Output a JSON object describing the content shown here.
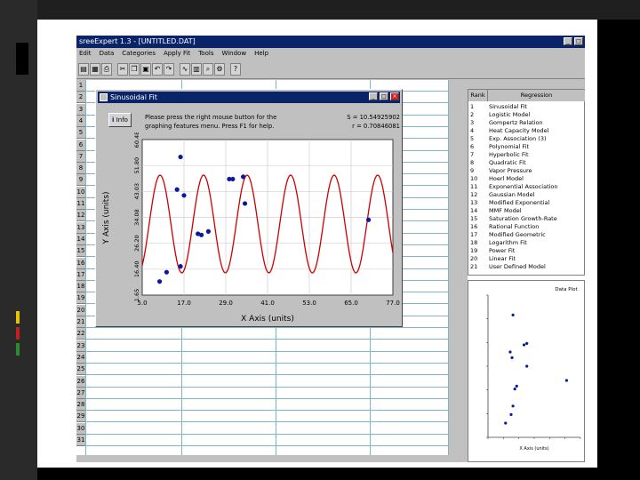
{
  "app": {
    "title": "sreeExpert 1.3 - [UNTITLED.DAT]",
    "menu": [
      "Edit",
      "Data",
      "Categories",
      "Apply Fit",
      "Tools",
      "Window",
      "Help"
    ]
  },
  "toolbar": {
    "icons": [
      "open-icon",
      "save-icon",
      "print-icon",
      "cut-icon",
      "copy-icon",
      "paste-icon",
      "undo-icon",
      "redo-icon",
      "fit-icon",
      "chart-icon",
      "zoom-icon",
      "settings-icon",
      "help-icon"
    ]
  },
  "sheet": {
    "row_labels": [
      "1",
      "2",
      "3",
      "4",
      "5",
      "6",
      "7",
      "8",
      "9",
      "10",
      "11",
      "12",
      "13",
      "14",
      "15",
      "16",
      "17",
      "18",
      "19",
      "20",
      "21",
      "22",
      "23",
      "24",
      "25",
      "26",
      "27",
      "28",
      "29",
      "30",
      "31"
    ]
  },
  "fit_window": {
    "title": "Sinusoidal Fit",
    "info_label": "Info",
    "help_line1": "Please press the right mouse button for the",
    "help_line2": "graphing features menu.  Press F1 for help.",
    "s_value": "S = 10.54925902",
    "r_value": "r = 0.70846081",
    "xlabel": "X Axis (units)",
    "ylabel": "Y Axis (units)"
  },
  "chart_data": {
    "type": "scatter",
    "xlabel": "X Axis (units)",
    "ylabel": "Y Axis (units)",
    "xlim": [
      5.0,
      77.0
    ],
    "ylim": [
      1.65,
      68.48
    ],
    "x_ticks": [
      "5.0",
      "17.0",
      "29.0",
      "41.0",
      "53.0",
      "65.0",
      "77.0"
    ],
    "y_ticks": [
      "1.65",
      "16.40",
      "26.20",
      "34.08",
      "43.03",
      "51.80",
      "60.48"
    ],
    "points": [
      {
        "x": 10.0,
        "y": 7.5
      },
      {
        "x": 12.0,
        "y": 11.5
      },
      {
        "x": 15.0,
        "y": 47.0
      },
      {
        "x": 16.0,
        "y": 61.0
      },
      {
        "x": 16.0,
        "y": 14.0
      },
      {
        "x": 17.0,
        "y": 44.5
      },
      {
        "x": 21.0,
        "y": 28.0
      },
      {
        "x": 22.0,
        "y": 27.5
      },
      {
        "x": 24.0,
        "y": 29.0
      },
      {
        "x": 30.0,
        "y": 51.5
      },
      {
        "x": 31.0,
        "y": 51.5
      },
      {
        "x": 34.0,
        "y": 52.5
      },
      {
        "x": 34.5,
        "y": 41.0
      },
      {
        "x": 70.0,
        "y": 34.0
      }
    ],
    "fit": {
      "offset": 32.2,
      "amplitude": 21.0,
      "period": 12.5,
      "phase_x": 7.0
    },
    "line_color": "#cc0000",
    "point_color": "#0a1aa0"
  },
  "regression_table": {
    "headers": [
      "Rank",
      "Regression"
    ],
    "rows": [
      {
        "n": "1",
        "name": "Sinusoidal Fit"
      },
      {
        "n": "2",
        "name": "Logistic Model"
      },
      {
        "n": "3",
        "name": "Gompertz Relation"
      },
      {
        "n": "4",
        "name": "Heat Capacity Model"
      },
      {
        "n": "5",
        "name": "Exp. Association (3)"
      },
      {
        "n": "6",
        "name": "Polynomial Fit"
      },
      {
        "n": "7",
        "name": "Hyperbolic Fit"
      },
      {
        "n": "8",
        "name": "Quadratic Fit"
      },
      {
        "n": "9",
        "name": "Vapor Pressure"
      },
      {
        "n": "10",
        "name": "Hoerl Model"
      },
      {
        "n": "11",
        "name": "Exponential Association"
      },
      {
        "n": "12",
        "name": "Gaussian Model"
      },
      {
        "n": "13",
        "name": "Modified Exponential"
      },
      {
        "n": "14",
        "name": "MMF Model"
      },
      {
        "n": "15",
        "name": "Saturation Growth-Rate"
      },
      {
        "n": "16",
        "name": "Rational Function"
      },
      {
        "n": "17",
        "name": "Modified Geometric"
      },
      {
        "n": "18",
        "name": "Logarithm Fit"
      },
      {
        "n": "19",
        "name": "Power Fit"
      },
      {
        "n": "20",
        "name": "Linear Fit"
      },
      {
        "n": "21",
        "name": "User Defined Model"
      }
    ]
  },
  "residual_plot": {
    "title": "Data Plot",
    "xlabel": "X Axis (units)",
    "points": [
      {
        "x": 0.27,
        "y": 0.86
      },
      {
        "x": 0.24,
        "y": 0.6
      },
      {
        "x": 0.26,
        "y": 0.56
      },
      {
        "x": 0.39,
        "y": 0.65
      },
      {
        "x": 0.42,
        "y": 0.66
      },
      {
        "x": 0.42,
        "y": 0.5
      },
      {
        "x": 0.29,
        "y": 0.34
      },
      {
        "x": 0.31,
        "y": 0.36
      },
      {
        "x": 0.27,
        "y": 0.22
      },
      {
        "x": 0.25,
        "y": 0.16
      },
      {
        "x": 0.19,
        "y": 0.1
      },
      {
        "x": 0.85,
        "y": 0.4
      }
    ],
    "point_color": "#0a1aa0"
  }
}
